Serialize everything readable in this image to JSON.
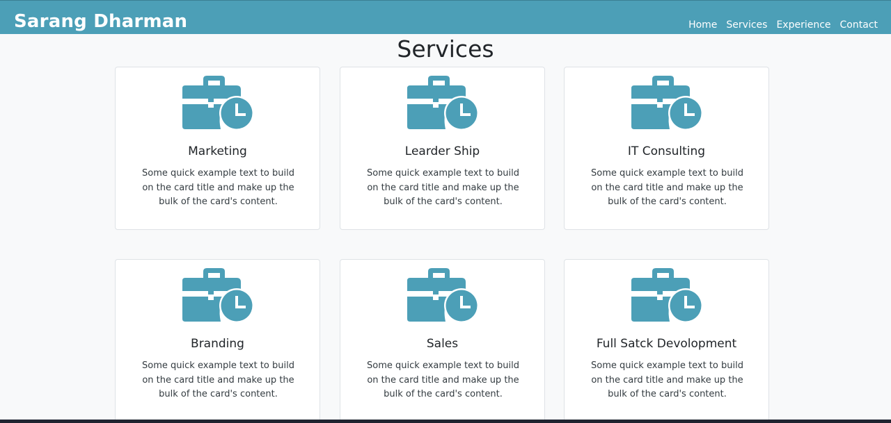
{
  "navbar": {
    "brand": "Sarang Dharman",
    "links": [
      {
        "label": "Home"
      },
      {
        "label": "Services"
      },
      {
        "label": "Experience"
      },
      {
        "label": "Contact"
      }
    ]
  },
  "section": {
    "title": "Services"
  },
  "colors": {
    "accent": "#4c9fb7",
    "background": "#f8f9fa",
    "card": "#ffffff"
  },
  "cards": [
    {
      "icon": "briefcase-clock-icon",
      "title": "Marketing",
      "text": "Some quick example text to build on the card title and make up the bulk of the card's content."
    },
    {
      "icon": "briefcase-clock-icon",
      "title": "Learder Ship",
      "text": "Some quick example text to build on the card title and make up the bulk of the card's content."
    },
    {
      "icon": "briefcase-clock-icon",
      "title": "IT Consulting",
      "text": "Some quick example text to build on the card title and make up the bulk of the card's content."
    },
    {
      "icon": "briefcase-clock-icon",
      "title": "Branding",
      "text": "Some quick example text to build on the card title and make up the bulk of the card's content."
    },
    {
      "icon": "briefcase-clock-icon",
      "title": "Sales",
      "text": "Some quick example text to build on the card title and make up the bulk of the card's content."
    },
    {
      "icon": "briefcase-clock-icon",
      "title": "Full Satck Devolopment",
      "text": "Some quick example text to build on the card title and make up the bulk of the card's content."
    }
  ]
}
